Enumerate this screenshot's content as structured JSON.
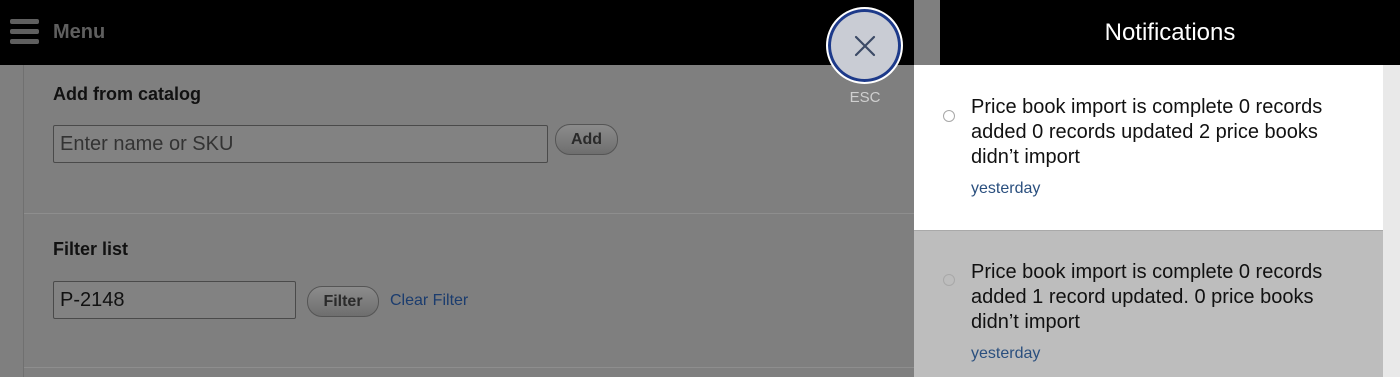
{
  "menu": {
    "label": "Menu",
    "icon": "hamburger-icon"
  },
  "catalog": {
    "title": "Add from catalog",
    "input_placeholder": "Enter name or SKU",
    "add_label": "Add"
  },
  "filter": {
    "title": "Filter list",
    "input_value": "P-2148",
    "filter_label": "Filter",
    "clear_label": "Clear Filter"
  },
  "close": {
    "icon": "close-icon",
    "esc_label": "ESC"
  },
  "notifications": {
    "title": "Notifications",
    "items": [
      {
        "text": "Price book import is complete 0 records added 0 records updated 2 price books didn’t import",
        "time": "yesterday",
        "active": true
      },
      {
        "text": "Price book import is complete 0 records added 1 record updated. 0 price books didn’t import",
        "time": "yesterday",
        "active": false
      }
    ]
  },
  "colors": {
    "accent_link": "#2a4f7e",
    "close_ring": "#1d3a8a"
  }
}
